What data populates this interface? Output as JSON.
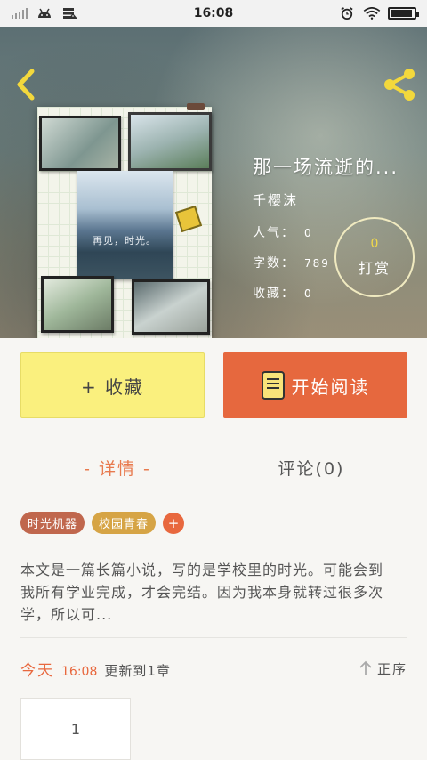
{
  "status_bar": {
    "time": "16:08",
    "left_icons": [
      "signal-icon",
      "android-icon",
      "storage-icon"
    ],
    "right_icons": [
      "alarm-icon",
      "wifi-icon",
      "battery-icon"
    ]
  },
  "header": {
    "back_icon": "chevron-left-icon",
    "share_icon": "share-icon",
    "accent_color": "#f3d83c"
  },
  "cover": {
    "caption": "再见，时光。"
  },
  "book": {
    "title": "那一场流逝的...",
    "author": "千樱沫",
    "stats": {
      "popularity_label": "人气：",
      "popularity_value": "0",
      "words_label": "字数：",
      "words_value": "789",
      "favorites_label": "收藏：",
      "favorites_value": "0"
    },
    "tip": {
      "count": "0",
      "label": "打赏"
    }
  },
  "actions": {
    "favorite_label": "+ 收藏",
    "favorite_color": "#faf07e",
    "read_label": "开始阅读",
    "read_color": "#e6683e"
  },
  "tabs": [
    {
      "label": "- 详情 -",
      "active": true
    },
    {
      "label": "评论(0)",
      "active": false
    }
  ],
  "tags": [
    {
      "label": "时光机器",
      "color": "#c0674d"
    },
    {
      "label": "校园青春",
      "color": "#d6a445"
    }
  ],
  "add_tag_label": "+",
  "description": "本文是一篇长篇小说，写的是学校里的时光。可能会到我所有学业完成，才会完结。因为我本身就转过很多次学，所以可...",
  "update": {
    "day": "今天",
    "time": "16:08",
    "text": "更新到1章",
    "order_label": "正序"
  },
  "chapters": [
    "1"
  ]
}
